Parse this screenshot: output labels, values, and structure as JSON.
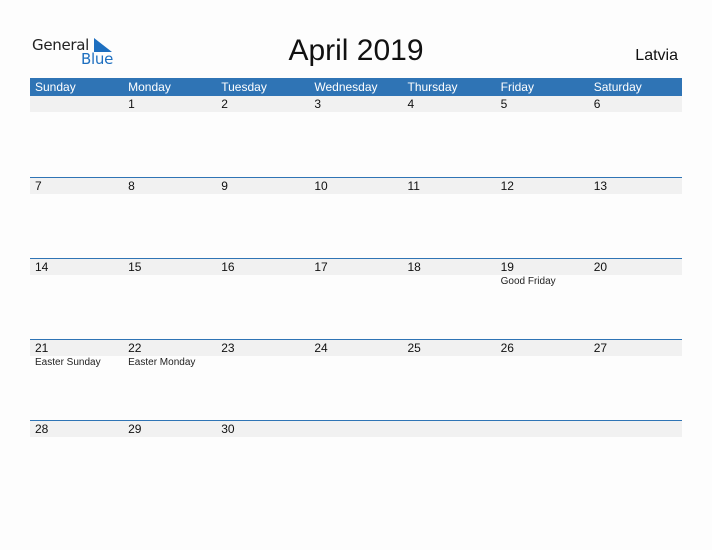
{
  "logo": {
    "general": "General",
    "blue": "Blue",
    "icon": "triangle-icon"
  },
  "title": "April 2019",
  "country": "Latvia",
  "colors": {
    "accent": "#2f74b5",
    "strip": "#f1f1f1",
    "logo_blue": "#1d6fc0"
  },
  "weekdays": [
    "Sunday",
    "Monday",
    "Tuesday",
    "Wednesday",
    "Thursday",
    "Friday",
    "Saturday"
  ],
  "weeks": [
    {
      "days": [
        "",
        "1",
        "2",
        "3",
        "4",
        "5",
        "6"
      ],
      "events": [
        "",
        "",
        "",
        "",
        "",
        "",
        ""
      ]
    },
    {
      "days": [
        "7",
        "8",
        "9",
        "10",
        "11",
        "12",
        "13"
      ],
      "events": [
        "",
        "",
        "",
        "",
        "",
        "",
        ""
      ]
    },
    {
      "days": [
        "14",
        "15",
        "16",
        "17",
        "18",
        "19",
        "20"
      ],
      "events": [
        "",
        "",
        "",
        "",
        "",
        "Good Friday",
        ""
      ]
    },
    {
      "days": [
        "21",
        "22",
        "23",
        "24",
        "25",
        "26",
        "27"
      ],
      "events": [
        "Easter Sunday",
        "Easter Monday",
        "",
        "",
        "",
        "",
        ""
      ]
    },
    {
      "days": [
        "28",
        "29",
        "30",
        "",
        "",
        "",
        ""
      ],
      "events": [
        "",
        "",
        "",
        "",
        "",
        "",
        ""
      ]
    }
  ]
}
